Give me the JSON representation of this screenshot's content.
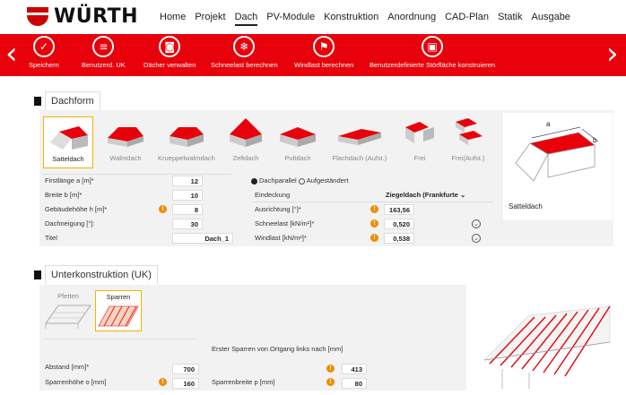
{
  "brand": {
    "name": "WÜRTH"
  },
  "nav": {
    "items": [
      "Home",
      "Projekt",
      "Dach",
      "PV-Module",
      "Konstruktion",
      "Anordnung",
      "CAD-Plan",
      "Statik",
      "Ausgabe"
    ],
    "active": "Dach"
  },
  "toolbar": {
    "tools": [
      "Speichern",
      "Benutzerd. UK",
      "Dächer verwalten",
      "Schneelast berechnen",
      "Windlast berechnen",
      "Benutzerdefinierte Störfläche konstruieren"
    ]
  },
  "dachform": {
    "title": "Dachform",
    "roof_types": [
      "Satteldach",
      "Walmdach",
      "Krueppelwalmdach",
      "Zeltdach",
      "Pultdach",
      "Flachdach (Aufst.)",
      "Frei",
      "Frei(Aufst.)"
    ],
    "selected": "Satteldach",
    "preview_label": "Satteldach",
    "preview_dims": {
      "a": "a",
      "b": "b"
    },
    "fields_left": [
      {
        "label": "Firstlänge a [m]*",
        "value": "12"
      },
      {
        "label": "Breite b [m]*",
        "value": "10"
      },
      {
        "label": "Gebäudehöhe h [m]*",
        "value": "8"
      },
      {
        "label": "Dachneigung [°]:",
        "value": "30"
      },
      {
        "label": "Titel",
        "value": "Dach_1"
      }
    ],
    "mount": {
      "option1": "Dachparallel",
      "option2": "Aufgeständert",
      "selected": "Dachparallel"
    },
    "fields_right": [
      {
        "label": "Eindeckung",
        "value": "Ziegeldach (Frankfurte"
      },
      {
        "label": "Ausrichtung [°]*",
        "value": "163,56"
      },
      {
        "label": "Schneelast [kN/m²]*",
        "value": "0,520"
      },
      {
        "label": "Windlast [kN/m²]*",
        "value": "0,538"
      }
    ]
  },
  "uk": {
    "title": "Unterkonstruktion (UK)",
    "types": [
      "Pfetten",
      "Sparren"
    ],
    "selected": "Sparren",
    "fields": [
      {
        "label": "Abstand [mm]*",
        "value": "700"
      },
      {
        "label": "Sparrenhöhe o [mm]",
        "value": "160"
      },
      {
        "label": "Erster Sparren von Ortgang links nach [mm]",
        "value": "413"
      },
      {
        "label": "Sparrenbreite p [mm]",
        "value": "80"
      }
    ]
  },
  "colors": {
    "accent": "#e8000b",
    "warning": "#f08c00",
    "highlight": "#f0b400"
  }
}
